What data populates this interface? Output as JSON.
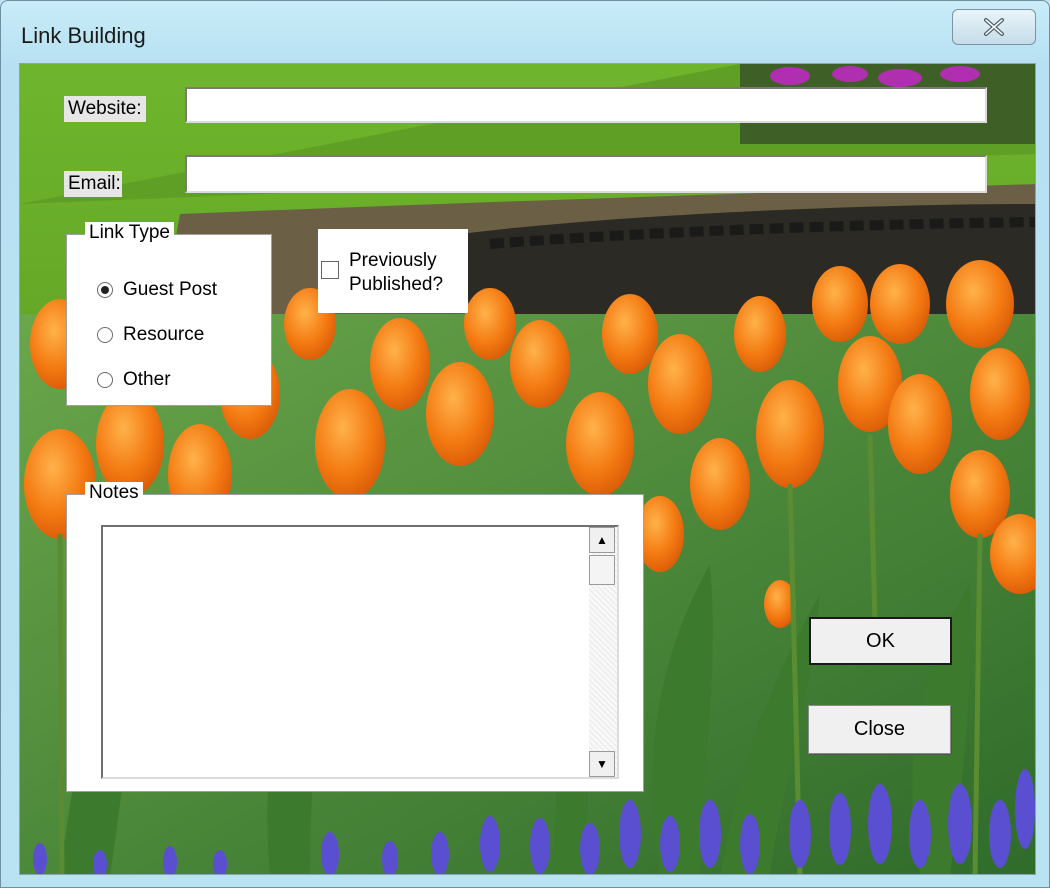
{
  "window": {
    "title": "Link Building"
  },
  "form": {
    "website_label": "Website:",
    "website_value": "",
    "email_label": "Email:",
    "email_value": "",
    "link_type": {
      "legend": "Link Type",
      "options": [
        {
          "label": "Guest Post",
          "selected": true
        },
        {
          "label": "Resource",
          "selected": false
        },
        {
          "label": "Other",
          "selected": false
        }
      ]
    },
    "previously_published": {
      "label_line1": "Previously",
      "label_line2": "Published?",
      "checked": false
    },
    "notes": {
      "legend": "Notes",
      "value": ""
    },
    "ok_label": "OK",
    "close_label": "Close"
  },
  "icons": {
    "window_close": "close-icon",
    "scroll_up": "scroll-up-arrow-icon",
    "scroll_down": "scroll-down-arrow-icon"
  },
  "colors": {
    "titlebar": "#b9e2f2",
    "control_bg": "#f0f0f0",
    "input_bg": "#ffffff"
  }
}
